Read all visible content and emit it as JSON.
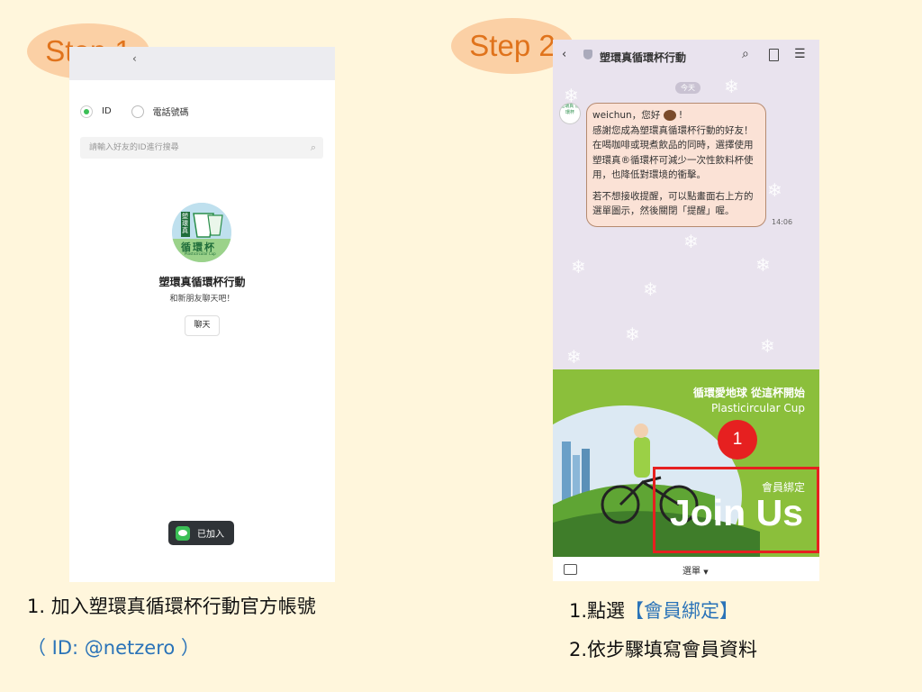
{
  "step1": {
    "badge": "Step 1",
    "radio_id_label": "ID",
    "radio_phone_label": "電話號碼",
    "search_placeholder": "請輸入好友的ID進行搜尋",
    "avatar_text_1": "塑環真",
    "avatar_text_2": "循環杯",
    "avatar_text_3": "Plasticircular Cup",
    "oa_name": "塑環真循環杯行動",
    "oa_subtitle": "和新朋友聊天吧！",
    "chat_button": "聊天",
    "added_label": "已加入",
    "caption_line1": "1. 加入塑環真循環杯行動官方帳號",
    "caption_line2": "（ ID: @netzero ）"
  },
  "step2": {
    "badge": "Step 2",
    "chat_title": "塑環真循環杯行動",
    "date_badge": "今天",
    "bot_avatar_text": "塑環真 循環杯",
    "message_greeting": "weichun，您好",
    "message_body1": "感謝您成為塑環真循環杯行動的好友！在喝咖啡或現煮飲品的同時，選擇使用塑環真®循環杯可減少一次性飲料杯使用，也降低對環境的衝擊。",
    "message_body2": "若不想接收提醒，可以點畫面右上方的選單圖示，然後關閉「提醒」喔。",
    "message_time": "14:06",
    "rich_slogan": "循環愛地球 從這杯開始",
    "rich_brand": "Plasticircular Cup",
    "rich_bind_label": "會員綁定",
    "rich_join": "Join Us",
    "callout_number": "1",
    "menu_label": "選單",
    "caption_line1_prefix": "1.點選",
    "caption_line1_highlight": "【會員綁定】",
    "caption_line2": "2.依步驟填寫會員資料"
  },
  "colors": {
    "background": "#fff6dc",
    "badge_fill": "#fbd0a5",
    "badge_text": "#e0731c",
    "line_green": "#3bbf56",
    "rich_green": "#8bbf3b",
    "highlight_red": "#e62020",
    "caption_blue": "#2a73b8"
  }
}
